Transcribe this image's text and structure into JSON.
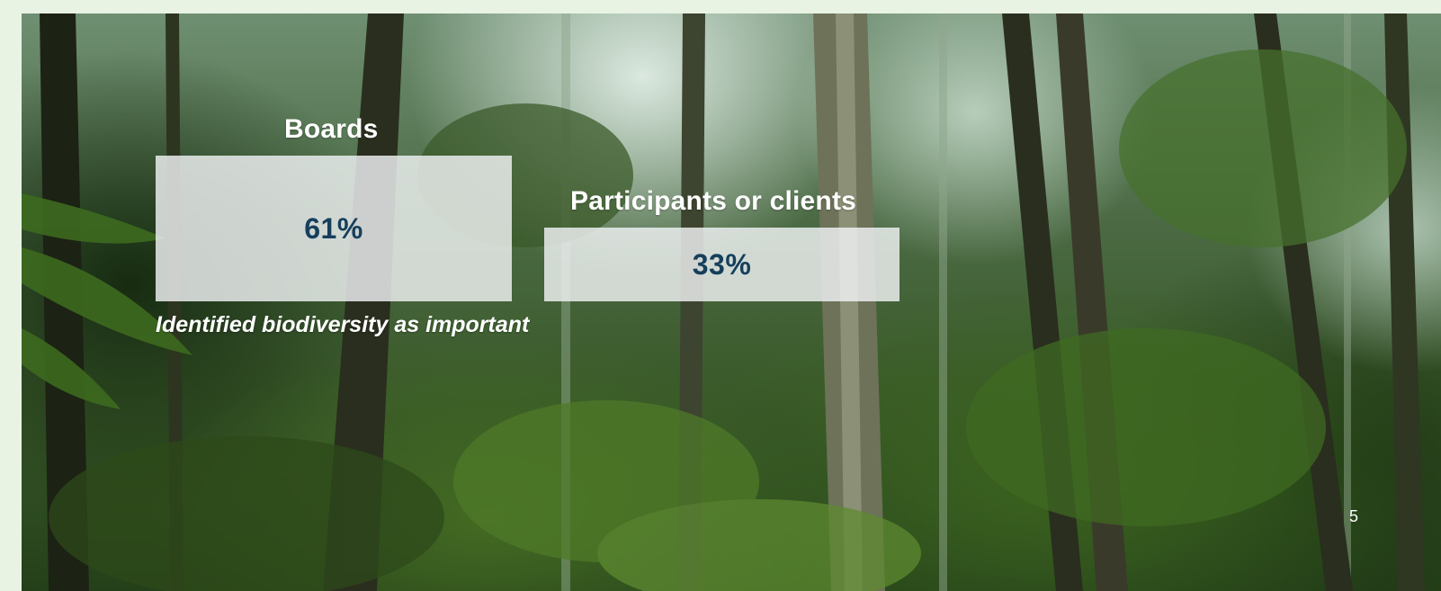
{
  "slide": {
    "stats": [
      {
        "title": "Boards",
        "value": "61%"
      },
      {
        "title": "Participants or clients",
        "value": "33%"
      }
    ],
    "caption": "Identified biodiversity as important",
    "page_number": "5"
  },
  "colors": {
    "page_background": "#e8f3e4",
    "box_fill": "#f0f3f4",
    "value_text": "#153f5c",
    "title_text": "#ffffff"
  }
}
